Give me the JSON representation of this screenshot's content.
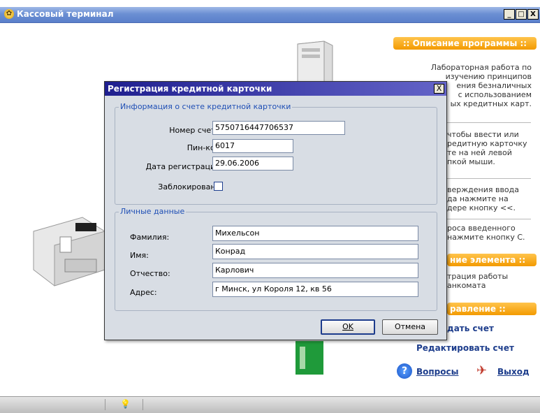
{
  "window": {
    "title": "Кассовый терминал",
    "buttons": {
      "minimize": "_",
      "maximize": "□",
      "close": "X"
    }
  },
  "sidebar": {
    "description_header": ":: Описание программы ::",
    "description_lines": [
      "Лабораторная работа по",
      "изучению принципов",
      "ения безналичных",
      "с использованием",
      "ых кредитных карт."
    ],
    "help1_lines": [
      "чтобы ввести или",
      "редитную карточку",
      "те на ней левой",
      "пкой мыши."
    ],
    "help2_lines": [
      "верждения ввода",
      "да нажмите на",
      "дере кнопку <<."
    ],
    "help3_lines": [
      "роса введенного",
      "нажмите кнопку С."
    ],
    "element_header": "ние элемента ::",
    "element_lines": [
      "трация работы",
      "анкомата"
    ],
    "control_header": "равление ::",
    "links": {
      "create_account": "дать счет",
      "edit_account": "Редактировать счет",
      "questions": "Вопросы",
      "exit": "Выход"
    }
  },
  "dialog": {
    "title": "Регистрация кредитной карточки",
    "close": "X",
    "account_group": {
      "label": "Информация о счете кредитной карточки",
      "account_number_label": "Номер счета:",
      "account_number_value": "5750716447706537",
      "pin_label": "Пин-код:",
      "pin_value": "6017",
      "reg_date_label": "Дата регистрации:",
      "reg_date_value": "29.06.2006",
      "blocked_label": "Заблокирована:",
      "blocked_checked": false
    },
    "personal_group": {
      "label": "Личные данные",
      "surname_label": "Фамилия:",
      "surname_value": "Михельсон",
      "name_label": "Имя:",
      "name_value": "Конрад",
      "patronymic_label": "Отчество:",
      "patronymic_value": "Карлович",
      "address_label": "Адрес:",
      "address_value": "г Минск, ул Короля 12, кв 56"
    },
    "ok_button": "OK",
    "cancel_button": "Отмена"
  },
  "colors": {
    "accent": "#f39a00",
    "link": "#1d3d8c",
    "dialog_title": "#1f1f8f",
    "group_label": "#1f4fb5"
  }
}
